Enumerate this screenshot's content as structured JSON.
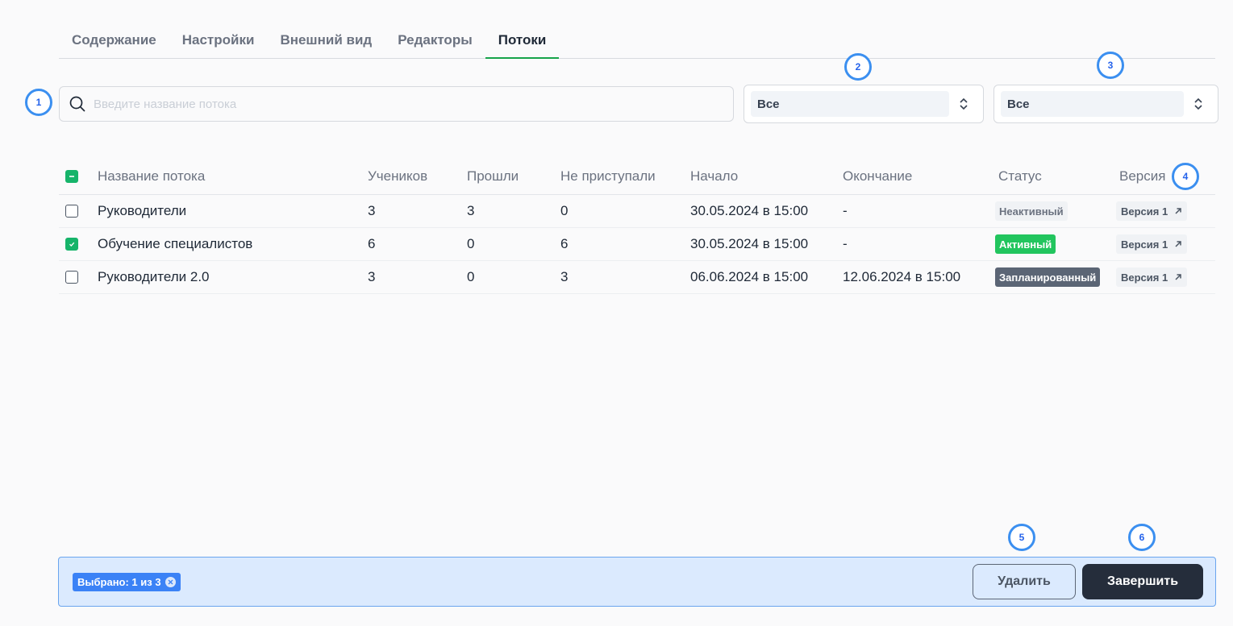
{
  "tabs": [
    {
      "label": "Содержание"
    },
    {
      "label": "Настройки"
    },
    {
      "label": "Внешний вид"
    },
    {
      "label": "Редакторы"
    },
    {
      "label": "Потоки"
    }
  ],
  "active_tab": "Потоки",
  "markers": [
    "1",
    "2",
    "3",
    "4",
    "5",
    "6"
  ],
  "search": {
    "placeholder": "Введите название потока",
    "value": ""
  },
  "filter1": {
    "value": "Все"
  },
  "filter2": {
    "value": "Все"
  },
  "table": {
    "headers": {
      "name": "Название потока",
      "students": "Учеников",
      "passed": "Прошли",
      "not_started": "Не приступали",
      "start": "Начало",
      "end": "Окончание",
      "status": "Статус",
      "version": "Версия"
    },
    "rows": [
      {
        "checked": false,
        "name": "Руководители",
        "students": "3",
        "passed": "3",
        "not_started": "0",
        "start": "30.05.2024 в 15:00",
        "end": "-",
        "status": "Неактивный",
        "status_kind": "inactive",
        "version": "Версия 1"
      },
      {
        "checked": true,
        "name": "Обучение специалистов",
        "students": "6",
        "passed": "0",
        "not_started": "6",
        "start": "30.05.2024 в 15:00",
        "end": "-",
        "status": "Активный",
        "status_kind": "active",
        "version": "Версия 1"
      },
      {
        "checked": false,
        "name": "Руководители 2.0",
        "students": "3",
        "passed": "0",
        "not_started": "3",
        "start": "06.06.2024 в 15:00",
        "end": "12.06.2024 в 15:00",
        "status": "Запланированный",
        "status_kind": "planned",
        "version": "Версия 1"
      }
    ]
  },
  "bottom_bar": {
    "selected_label": "Выбрано: 1 из 3",
    "delete_label": "Удалить",
    "finish_label": "Завершить"
  },
  "colors": {
    "accent_green": "#16a34a",
    "active_status": "#22c55e",
    "planned_status": "#5b6575",
    "bar_background": "#dbeafe",
    "marker_blue": "#3b8ff0"
  }
}
